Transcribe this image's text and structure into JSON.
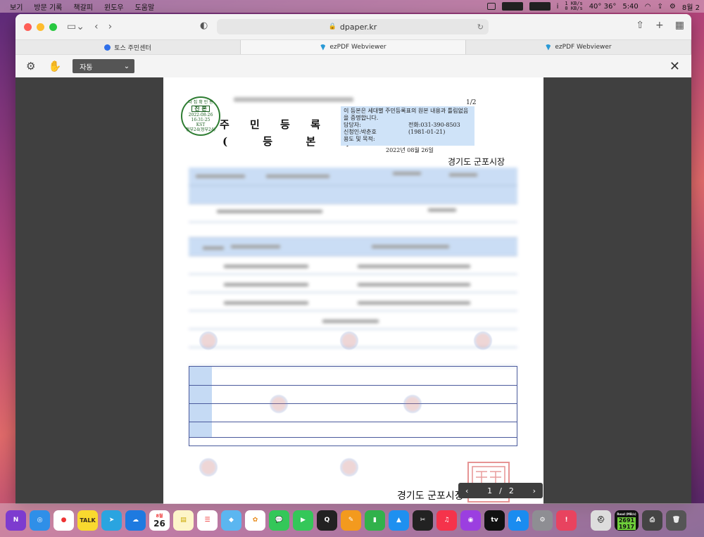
{
  "menubar": {
    "items": [
      "보기",
      "방문 기록",
      "책갈피",
      "윈도우",
      "도움말"
    ],
    "net_up": "1 KB/s",
    "net_down": "0 KB/s",
    "temps": "40° 36°",
    "clock": "5:40",
    "date_fragment": "8월 2"
  },
  "browser": {
    "url": "dpaper.kr",
    "tabs": [
      {
        "label": "토스 주민센터"
      },
      {
        "label": "ezPDF Webviewer"
      },
      {
        "label": "ezPDF Webviewer"
      }
    ]
  },
  "viewer": {
    "zoom_value": "자동",
    "page_current": "1",
    "page_sep": "/",
    "page_total": "2"
  },
  "document": {
    "page_indicator": "1/2",
    "seal": {
      "line1": "다 집 확 인 용",
      "big": "진 본",
      "date": "2022-08-26",
      "time": "16:31:25",
      "kst": "KST",
      "org": "정부24(정부24)"
    },
    "title": "주 민 등 록 표",
    "subtitle": [
      "(",
      "등",
      "본",
      ")"
    ],
    "cert_text": "이 등본은 세대별 주민등록표의 원본 내용과 틀림없음을 증명합니다.",
    "handler_label": "담당자:",
    "phone": "전화:031-390-8503",
    "applicant": "신청인:박춘호",
    "birth": "(1981-01-21)",
    "purpose": "용도 및 목적:",
    "issue_date": "2022년 08월 26일",
    "issuer": "경기도 군포시장",
    "issuer_bottom": "경기도 군포시장"
  },
  "dock": {
    "calendar_day": "26",
    "calendar_month": "8월",
    "read_label": "Read (MB/s)",
    "read_val1": "2691",
    "read_val2": "1917"
  }
}
